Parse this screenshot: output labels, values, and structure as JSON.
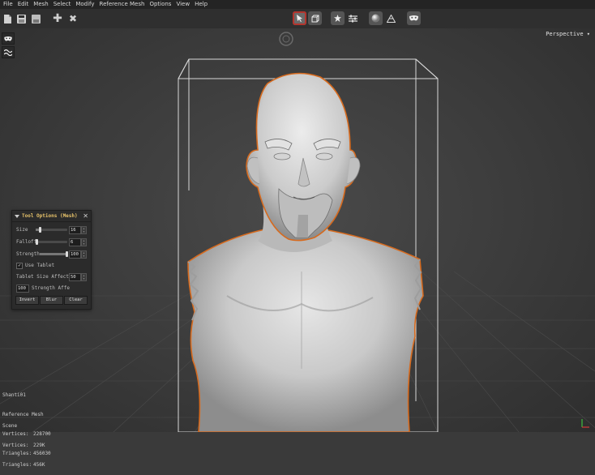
{
  "menu": [
    "File",
    "Edit",
    "Mesh",
    "Select",
    "Modify",
    "Reference Mesh",
    "Options",
    "View",
    "Help"
  ],
  "toolbar": {
    "left_icons": [
      "new-file-icon",
      "save-icon",
      "save-as-icon",
      "add-icon",
      "delete-icon"
    ],
    "center_icons": [
      "select-mode-icon",
      "mesh-view-icon",
      "sculpt-icon",
      "settings-icon",
      "sphere-material-icon",
      "wireframe-icon",
      "mask-icon"
    ],
    "active_icon": "select-mode-icon",
    "accent_color": "#b3342d"
  },
  "viewport": {
    "camera_label": "Perspective",
    "camera_label_suffix": "▾",
    "selection_outline_color": "#d2691e"
  },
  "left_tools": [
    "mask-tool-icon",
    "smooth-brush-icon"
  ],
  "tool_options": {
    "title": "Tool Options (Mesh)",
    "size_label": "Size",
    "size_value": "16",
    "falloff_label": "Falloff",
    "falloff_value": "6",
    "strength_label": "Strength",
    "strength_value": "100",
    "strength_level": 1.0,
    "size_level": 0.16,
    "falloff_level": 0.06,
    "use_tablet_label": "Use Tablet",
    "use_tablet_checked": true,
    "tablet_size_label": "Tablet Size Affect",
    "tablet_size_value": "50",
    "tablet_strength_value": "100",
    "tablet_strength_label": "Strength Affe",
    "buttons": [
      "Invert",
      "Blur",
      "Clear"
    ]
  },
  "stats": {
    "object_name": "Shanti01",
    "reference_label": "Reference Mesh",
    "ref_vertices_key": "Vertices:",
    "ref_vertices": "228700",
    "ref_triangles_key": "Triangles:",
    "ref_triangles": "456030",
    "scene_label": "Scene",
    "scene_vertices_key": "Vertices:",
    "scene_vertices": "229K",
    "scene_triangles_key": "Triangles:",
    "scene_triangles": "456K"
  }
}
